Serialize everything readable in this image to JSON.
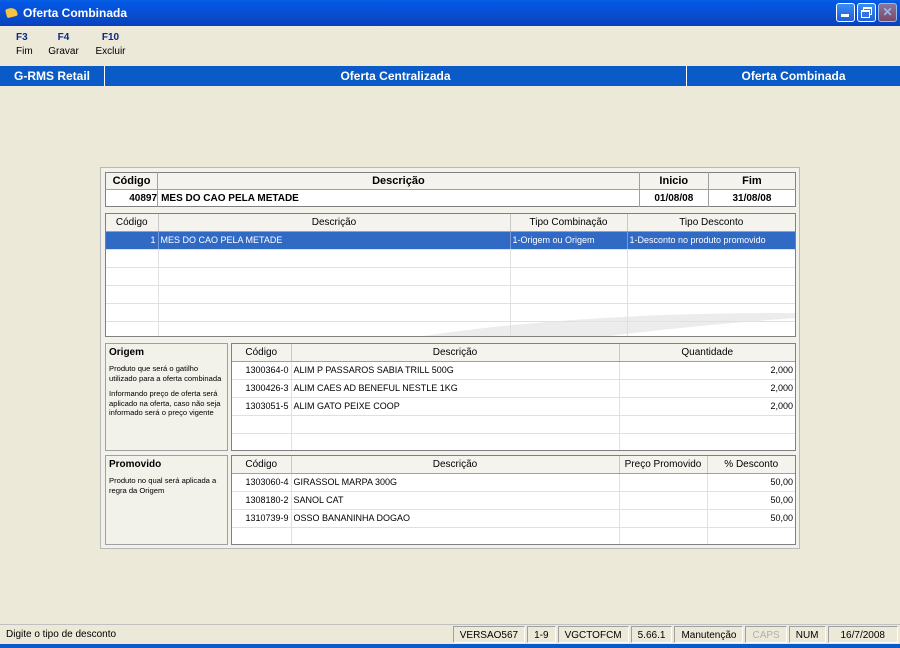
{
  "window": {
    "title": "Oferta Combinada"
  },
  "toolbar": [
    {
      "key": "F3",
      "label": "Fim"
    },
    {
      "key": "F4",
      "label": "Gravar"
    },
    {
      "key": "F10",
      "label": "Excluir"
    }
  ],
  "banner": {
    "app": "G-RMS Retail",
    "module": "Oferta Centralizada",
    "screen": "Oferta Combinada"
  },
  "header": {
    "cols": {
      "codigo": "Código",
      "descricao": "Descrição",
      "inicio": "Inicio",
      "fim": "Fim"
    },
    "row": {
      "codigo": "40897",
      "descricao": "MES DO CAO PELA METADE",
      "inicio": "01/08/08",
      "fim": "31/08/08"
    }
  },
  "combinations": {
    "cols": {
      "codigo": "Código",
      "descricao": "Descrição",
      "tipo_combinacao": "Tipo Combinação",
      "tipo_desconto": "Tipo Desconto"
    },
    "rows": [
      {
        "codigo": "1",
        "descricao": "MES DO CAO PELA METADE",
        "tipo_combinacao": "1-Origem ou Origem",
        "tipo_desconto": "1-Desconto no produto promovido"
      }
    ]
  },
  "origem": {
    "title": "Origem",
    "help1": "Produto que será o gatilho utilizado para a oferta combinada",
    "help2": "Informando preço de oferta será aplicado na oferta, caso não seja informado será o preço vigente",
    "cols": {
      "codigo": "Código",
      "descricao": "Descrição",
      "quantidade": "Quantidade"
    },
    "rows": [
      {
        "codigo": "1300364-0",
        "descricao": "ALIM P PASSAROS SABIA TRILL 500G",
        "quantidade": "2,000"
      },
      {
        "codigo": "1300426-3",
        "descricao": "ALIM CAES AD BENEFUL NESTLE 1KG",
        "quantidade": "2,000"
      },
      {
        "codigo": "1303051-5",
        "descricao": "ALIM GATO PEIXE COOP",
        "quantidade": "2,000"
      }
    ]
  },
  "promovido": {
    "title": "Promovido",
    "help1": "Produto no qual será aplicada a regra da Origem",
    "cols": {
      "codigo": "Código",
      "descricao": "Descrição",
      "preco": "Preço Promovido",
      "desconto": "% Desconto"
    },
    "rows": [
      {
        "codigo": "1303060-4",
        "descricao": "GIRASSOL MARPA 300G",
        "preco": "",
        "desconto": "50,00"
      },
      {
        "codigo": "1308180-2",
        "descricao": "SANOL CAT",
        "preco": "",
        "desconto": "50,00"
      },
      {
        "codigo": "1310739-9",
        "descricao": "OSSO BANANINHA DOGAO",
        "preco": "",
        "desconto": "50,00"
      }
    ]
  },
  "status": {
    "message": "Digite o tipo de desconto",
    "version": "VERSAO567",
    "range": "1-9",
    "program": "VGCTOFCM",
    "build": "5.66.1",
    "mode": "Manutenção",
    "caps": "CAPS",
    "num": "NUM",
    "date": "16/7/2008"
  }
}
